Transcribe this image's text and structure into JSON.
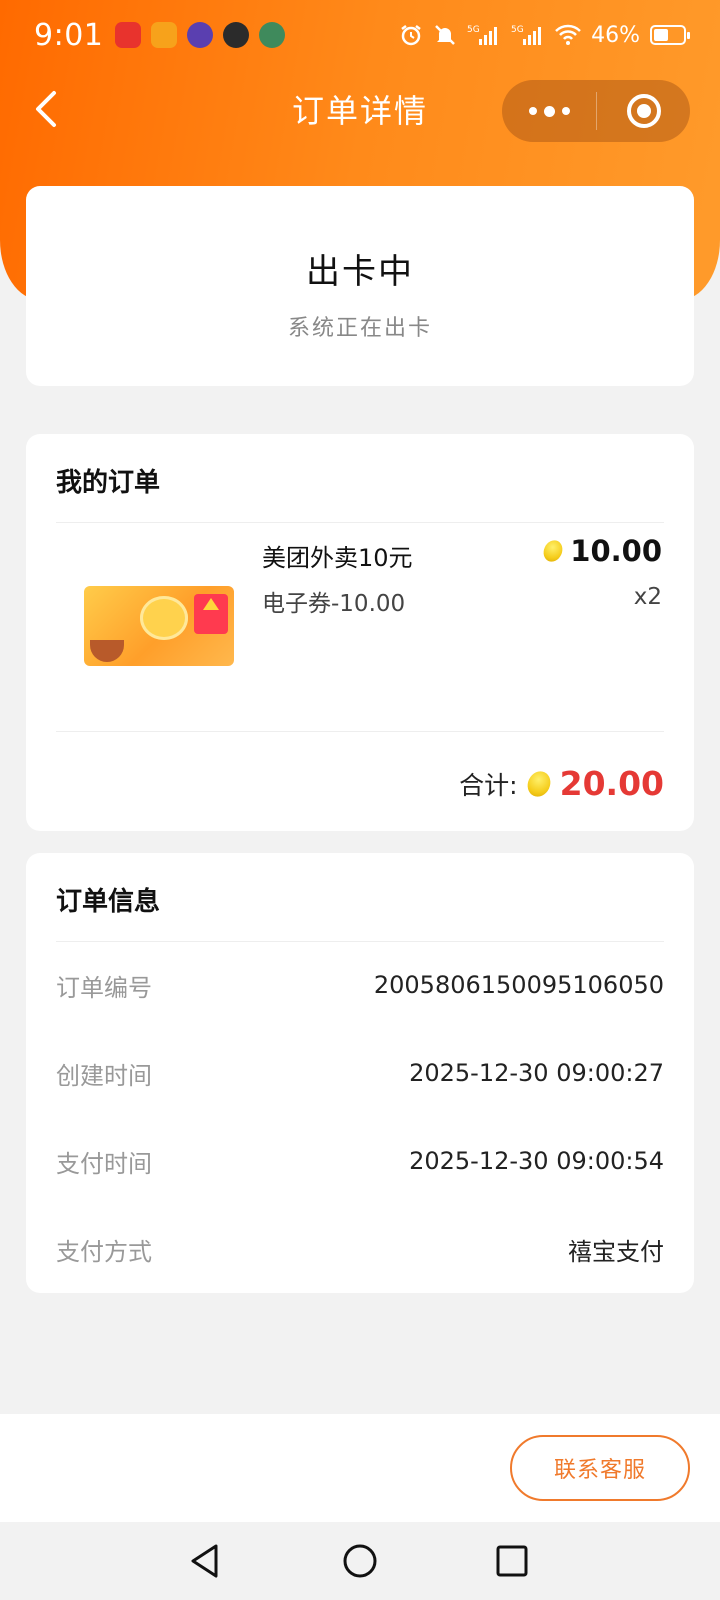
{
  "status_bar": {
    "time": "9:01",
    "battery": "46%",
    "network": "5G",
    "apps": [
      {
        "name": "digital-rmb-app-icon",
        "color": "#e8332d"
      },
      {
        "name": "game-center-app-icon",
        "color": "#f7a21b"
      },
      {
        "name": "city-game-app-icon",
        "color": "#5a3fb0"
      },
      {
        "name": "moba-game-app-icon",
        "color": "#2b2b2b"
      },
      {
        "name": "card-game-app-icon",
        "color": "#3f8a5c"
      }
    ],
    "indicators": [
      "alarm-icon",
      "mute-icon",
      "signal-5g-icon",
      "signal-5g-icon",
      "wifi-icon",
      "battery-icon"
    ]
  },
  "nav": {
    "title": "订单详情",
    "back_icon": "back-arrow-icon",
    "more_icon": "more-dots-icon",
    "close_icon": "close-circle-icon"
  },
  "status": {
    "title": "出卡中",
    "subtitle": "系统正在出卡"
  },
  "order": {
    "section_title": "我的订单",
    "item": {
      "name": "美团外卖10元",
      "spec": "电子券-10.00",
      "price": "10.00",
      "qty": "x2",
      "image_icon": "meituan-voucher-image"
    },
    "total_label": "合计:",
    "total_amount": "20.00",
    "currency_icon": "gold-bean-icon"
  },
  "info": {
    "section_title": "订单信息",
    "rows": [
      {
        "label": "订单编号",
        "value": "2005806150095106050"
      },
      {
        "label": "创建时间",
        "value": "2025-12-30 09:00:27"
      },
      {
        "label": "支付时间",
        "value": "2025-12-30 09:00:54"
      },
      {
        "label": "支付方式",
        "value": "禧宝支付"
      }
    ]
  },
  "footer": {
    "contact_button": "联系客服"
  },
  "system_nav": [
    "nav-back-icon",
    "nav-home-icon",
    "nav-recents-icon"
  ],
  "colors": {
    "brand": "#ff7a12",
    "accent_red": "#e53935",
    "button_border": "#f07a2c"
  }
}
